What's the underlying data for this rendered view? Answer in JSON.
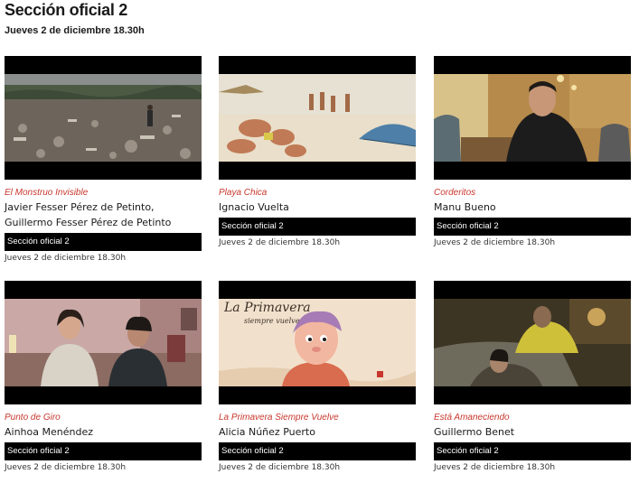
{
  "page": {
    "title": "Sección oficial 2",
    "subtitle": "Jueves 2 de diciembre 18.30h"
  },
  "films": [
    {
      "title": "El Monstruo Invisible",
      "director": "Javier Fesser Pérez de Petinto, Guillermo Fesser Pérez de Petinto",
      "section": "Sección oficial 2",
      "datetime": "Jueves 2 de diciembre 18.30h",
      "scene": "landfill-scene"
    },
    {
      "title": "Playa Chica",
      "director": "Ignacio Vuelta",
      "section": "Sección oficial 2",
      "datetime": "Jueves 2 de diciembre 18.30h",
      "scene": "beach-scene"
    },
    {
      "title": "Corderitos",
      "director": "Manu Bueno",
      "section": "Sección oficial 2",
      "datetime": "Jueves 2 de diciembre 18.30h",
      "scene": "bar-scene"
    },
    {
      "title": "Punto de Giro",
      "director": "Ainhoa Menéndez",
      "section": "Sección oficial 2",
      "datetime": "Jueves 2 de diciembre 18.30h",
      "scene": "interior-couple-scene"
    },
    {
      "title": "La Primavera Siempre Vuelve",
      "director": "Alicia Núñez Puerto",
      "section": "Sección oficial 2",
      "datetime": "Jueves 2 de diciembre 18.30h",
      "scene": "animation-scene",
      "poster_text": "La Primavera",
      "poster_subtext": "siempre vuelve"
    },
    {
      "title": "Está Amaneciendo",
      "director": "Guillermo Benet",
      "section": "Sección oficial 2",
      "datetime": "Jueves 2 de diciembre 18.30h",
      "scene": "sofa-scene"
    }
  ],
  "colors": {
    "accent": "#c8372d",
    "badge_bg": "#000000",
    "badge_text": "#ffffff"
  }
}
